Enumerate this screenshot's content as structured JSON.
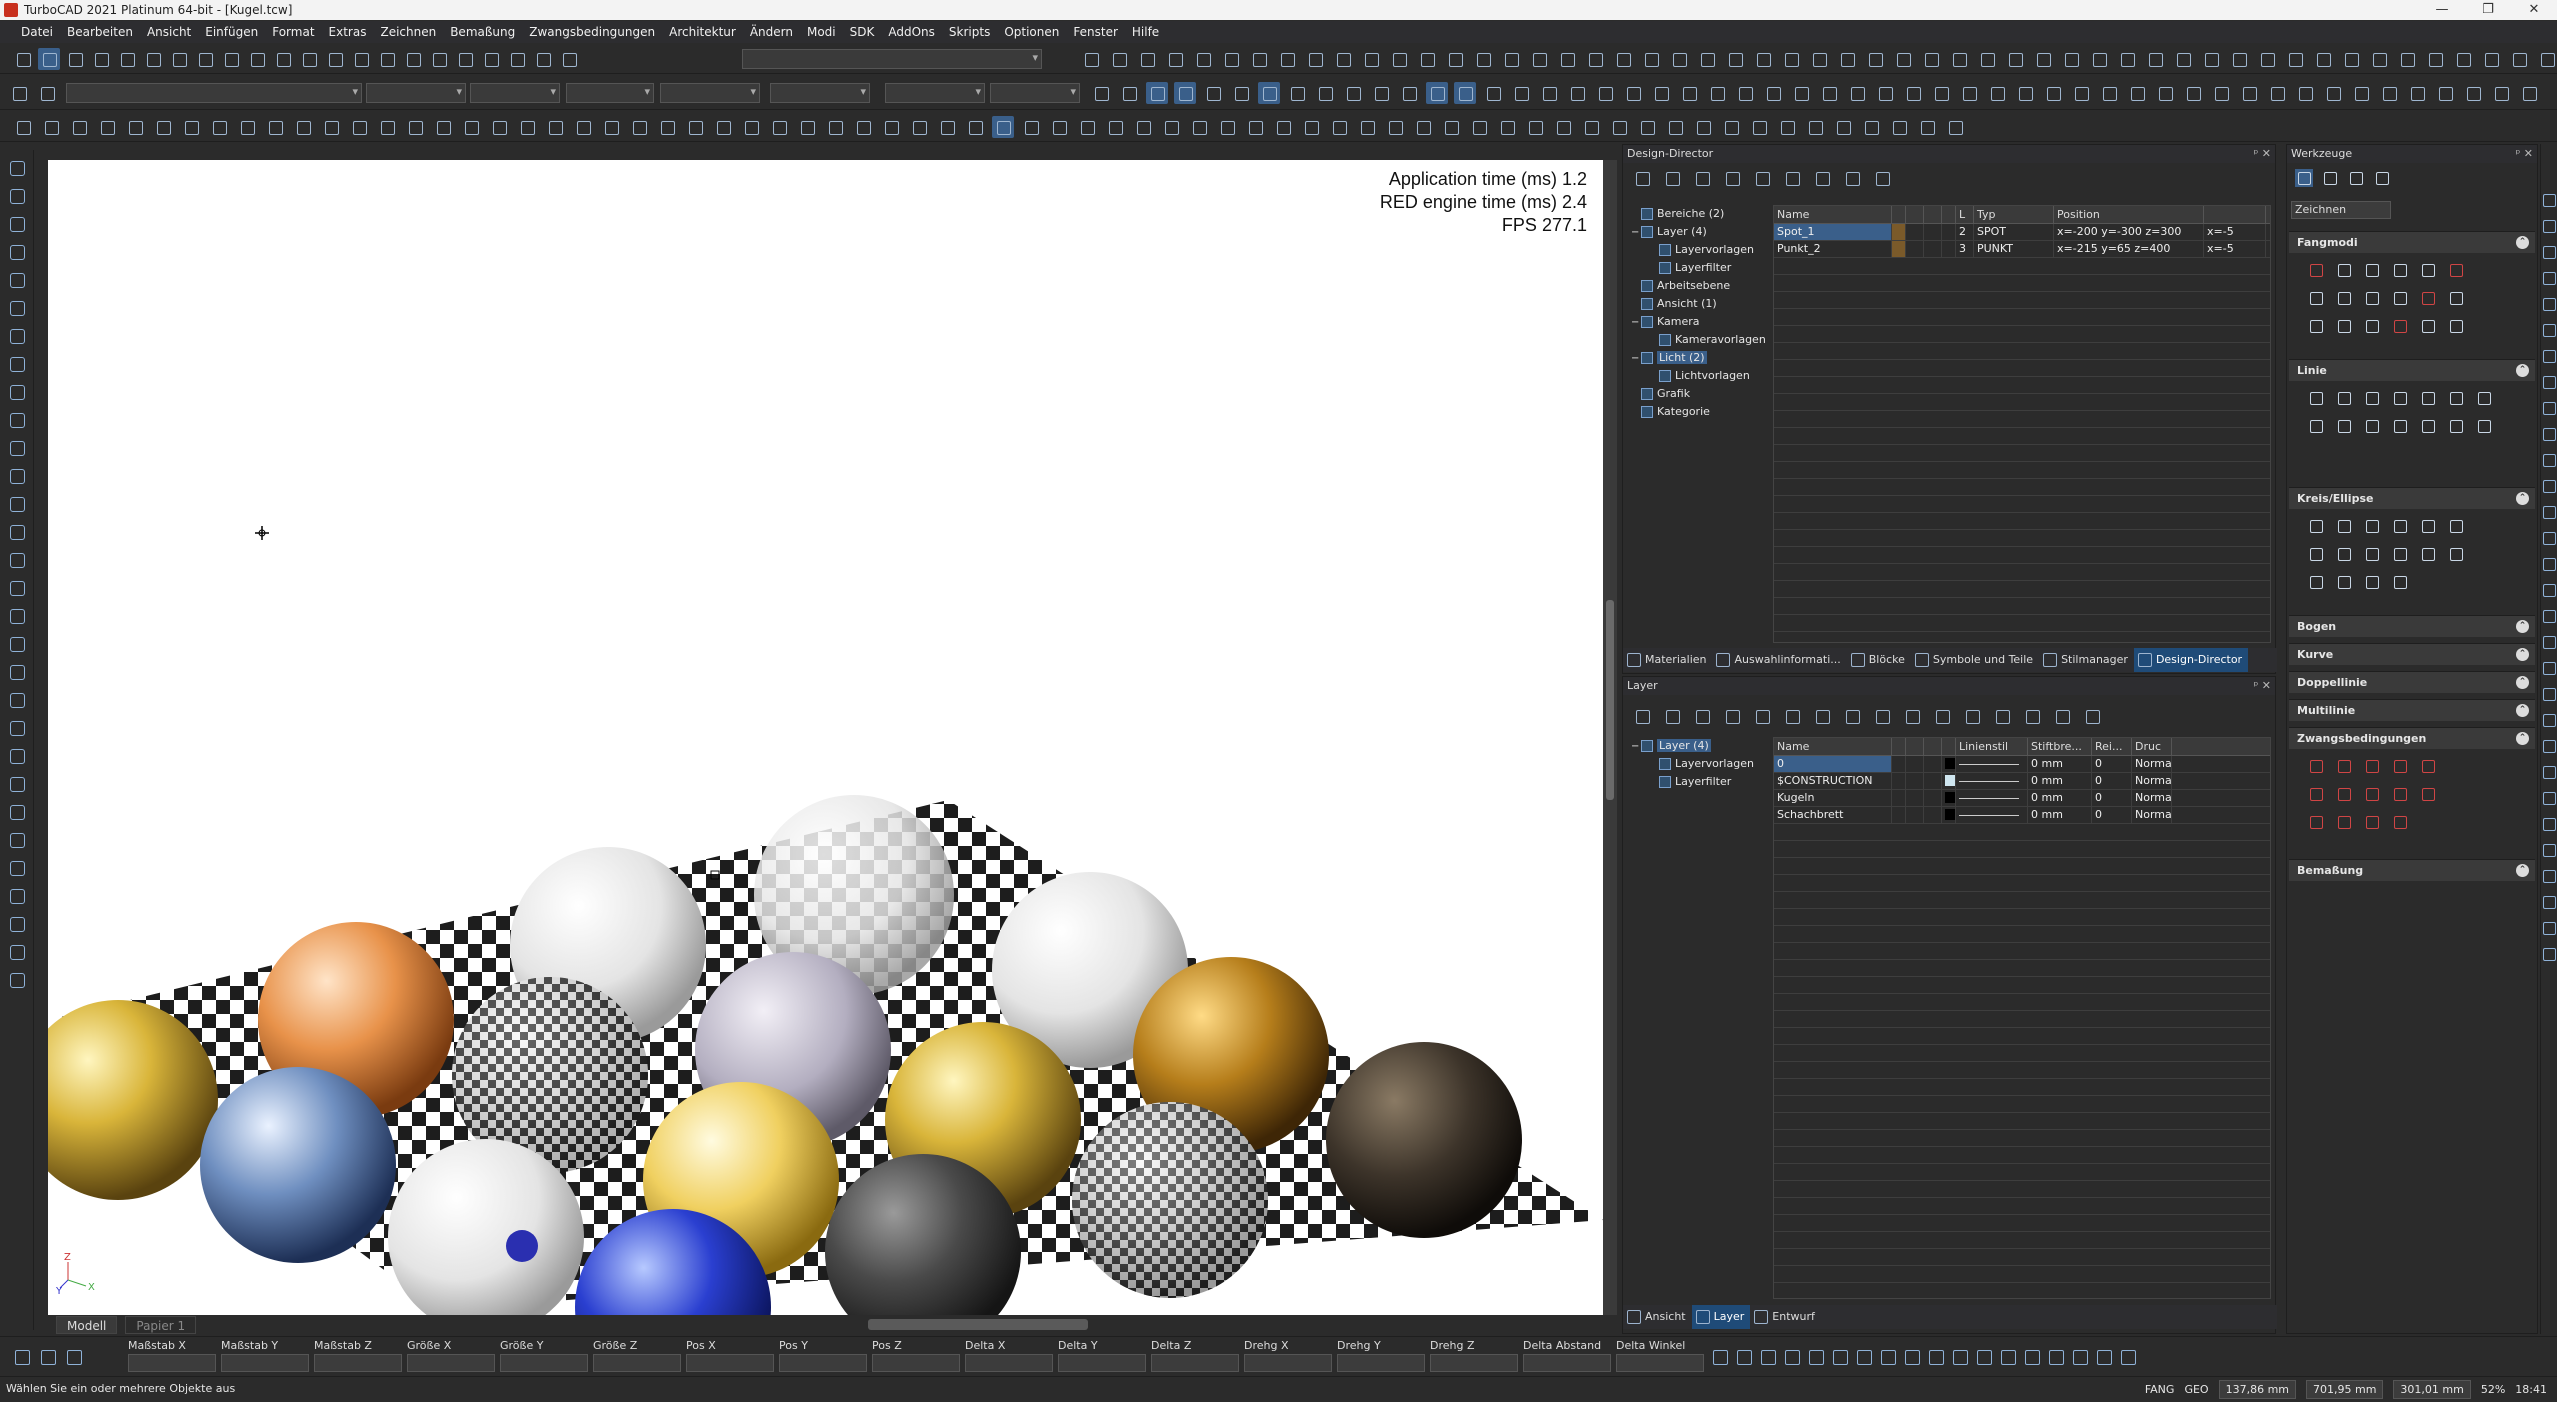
{
  "window": {
    "title": "TurboCAD 2021 Platinum 64-bit - [Kugel.tcw]",
    "controls": [
      "—",
      "❐",
      "✕"
    ]
  },
  "menu": [
    "Datei",
    "Bearbeiten",
    "Ansicht",
    "Einfügen",
    "Format",
    "Extras",
    "Zeichnen",
    "Bemaßung",
    "Zwangsbedingungen",
    "Architektur",
    "Ändern",
    "Modi",
    "SDK",
    "AddOns",
    "Skripts",
    "Optionen",
    "Fenster",
    "Hilfe"
  ],
  "viewport": {
    "stats": [
      {
        "label": "Application time (ms)",
        "value": "1.2"
      },
      {
        "label": "RED engine time (ms)",
        "value": "2.4"
      },
      {
        "label": "FPS",
        "value": "277.1"
      }
    ],
    "axis_labels": {
      "z": "Z",
      "y": "Y",
      "x": "X"
    }
  },
  "sheet_tabs": [
    "Modell",
    "Papier 1"
  ],
  "design_director": {
    "title": "Design-Director",
    "tree": [
      {
        "label": "Bereiche (2)",
        "indent": 0,
        "expand": ""
      },
      {
        "label": "Layer (4)",
        "indent": 0,
        "expand": "−"
      },
      {
        "label": "Layervorlagen",
        "indent": 1,
        "expand": ""
      },
      {
        "label": "Layerfilter",
        "indent": 1,
        "expand": ""
      },
      {
        "label": "Arbeitsebene",
        "indent": 0,
        "expand": ""
      },
      {
        "label": "Ansicht (1)",
        "indent": 0,
        "expand": ""
      },
      {
        "label": "Kamera",
        "indent": 0,
        "expand": "−"
      },
      {
        "label": "Kameravorlagen",
        "indent": 1,
        "expand": ""
      },
      {
        "label": "Licht (2)",
        "indent": 0,
        "expand": "−",
        "selected": true
      },
      {
        "label": "Lichtvorlagen",
        "indent": 1,
        "expand": ""
      },
      {
        "label": "Grafik",
        "indent": 0,
        "expand": ""
      },
      {
        "label": "Kategorie",
        "indent": 0,
        "expand": ""
      }
    ],
    "columns": [
      "Name",
      "",
      "",
      "",
      "",
      "L",
      "Typ",
      "Position",
      ""
    ],
    "rows": [
      {
        "name": "Spot_1",
        "l": "2",
        "typ": "SPOT",
        "position": "x=-200 y=-300 z=300",
        "extra": "x=-5",
        "selected": true
      },
      {
        "name": "Punkt_2",
        "l": "3",
        "typ": "PUNKT",
        "position": "x=-215 y=65 z=400",
        "extra": "x=-5"
      }
    ],
    "tabs": [
      "Materialien",
      "Auswahlinformati...",
      "Blöcke",
      "Symbole und Teile",
      "Stilmanager",
      "Design-Director"
    ],
    "active_tab": "Design-Director"
  },
  "layer_panel": {
    "title": "Layer",
    "tree": [
      {
        "label": "Layer (4)",
        "indent": 0,
        "expand": "−",
        "selected": true
      },
      {
        "label": "Layervorlagen",
        "indent": 1,
        "expand": ""
      },
      {
        "label": "Layerfilter",
        "indent": 1,
        "expand": ""
      }
    ],
    "columns": [
      "Name",
      "",
      "",
      "",
      "",
      "Linienstil",
      "Stiftbre...",
      "Rei...",
      "Druc"
    ],
    "rows": [
      {
        "name": "0",
        "width": "0 mm",
        "rei": "0",
        "druck": "Normal",
        "selected": true,
        "color": "#000000"
      },
      {
        "name": "$CONSTRUCTION",
        "width": "0 mm",
        "rei": "0",
        "druck": "Normal",
        "color": "#cfe6f0"
      },
      {
        "name": "Kugeln",
        "width": "0 mm",
        "rei": "0",
        "druck": "Normal",
        "color": "#000000"
      },
      {
        "name": "Schachbrett",
        "width": "0 mm",
        "rei": "0",
        "druck": "Normal",
        "color": "#000000"
      }
    ],
    "tabs": [
      "Ansicht",
      "Layer",
      "Entwurf"
    ],
    "active_tab": "Layer"
  },
  "tools_panel": {
    "title": "Werkzeuge",
    "dropdown": "Zeichnen",
    "sections": [
      "Fangmodi",
      "Linie",
      "Kreis/Ellipse",
      "Bogen",
      "Kurve",
      "Doppellinie",
      "Multilinie",
      "Zwangsbedingungen",
      "Bemaßung"
    ]
  },
  "inspector": {
    "fields": [
      "Maßstab X",
      "Maßstab Y",
      "Maßstab Z",
      "Größe X",
      "Größe Y",
      "Größe Z",
      "Pos X",
      "Pos Y",
      "Pos Z",
      "Delta X",
      "Delta Y",
      "Delta Z",
      "Drehg X",
      "Drehg Y",
      "Drehg Z",
      "Delta Abstand",
      "Delta Winkel"
    ]
  },
  "status": {
    "message": "Wählen Sie ein oder mehrere Objekte aus",
    "fang": "FANG",
    "geo": "GEO",
    "x": "137,86 mm",
    "y": "701,95 mm",
    "z": "301,01 mm",
    "zoom": "52%",
    "time": "18:41"
  },
  "colors": {
    "accent": "#3a5f8a",
    "active_tab": "#1f4b78",
    "panel_bg": "#2b2b2b"
  },
  "chart_data": null
}
